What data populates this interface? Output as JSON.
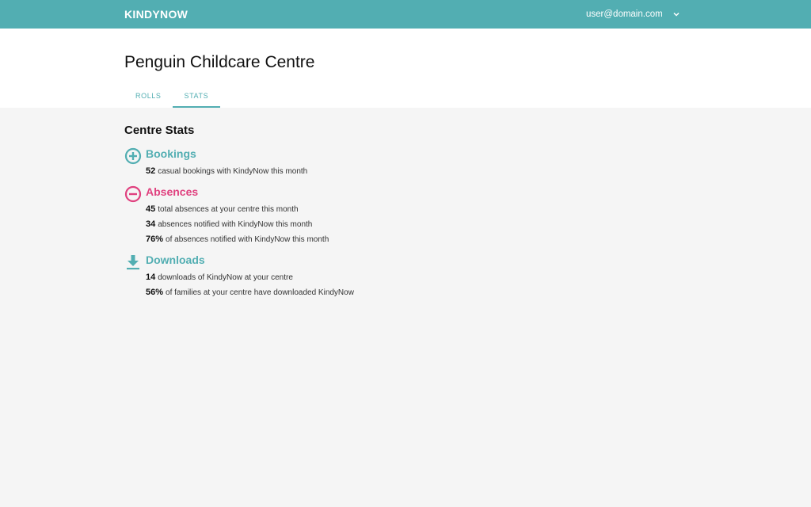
{
  "app": {
    "brand": "KINDYNOW"
  },
  "user_menu": {
    "email": "user@domain.com",
    "icon": "chevron-down-icon"
  },
  "centre": {
    "name": "Penguin Childcare Centre"
  },
  "tabs": [
    {
      "label": "ROLLS",
      "active": false
    },
    {
      "label": "STATS",
      "active": true
    }
  ],
  "stats": {
    "heading": "Centre Stats",
    "bookings": {
      "title": "Bookings",
      "icon": "plus-circle-icon",
      "color": "#52aeb2",
      "lines": [
        {
          "value": "52",
          "text": "casual bookings with KindyNow this month"
        }
      ]
    },
    "absences": {
      "title": "Absences",
      "icon": "minus-circle-icon",
      "color": "#e0417f",
      "lines": [
        {
          "value": "45",
          "text": "total absences at your centre this month"
        },
        {
          "value": "34",
          "text": "absences notified with KindyNow this month"
        },
        {
          "value": "76%",
          "text": "of absences notified with KindyNow this month"
        }
      ]
    },
    "downloads": {
      "title": "Downloads",
      "icon": "download-icon",
      "color": "#52aeb2",
      "lines": [
        {
          "value": "14",
          "text": "downloads of KindyNow at your centre"
        },
        {
          "value": "56%",
          "text": "of families at your centre have downloaded KindyNow"
        }
      ]
    }
  },
  "colors": {
    "accent": "#52aeb2",
    "negative": "#e0417f",
    "background": "#f5f5f5"
  }
}
